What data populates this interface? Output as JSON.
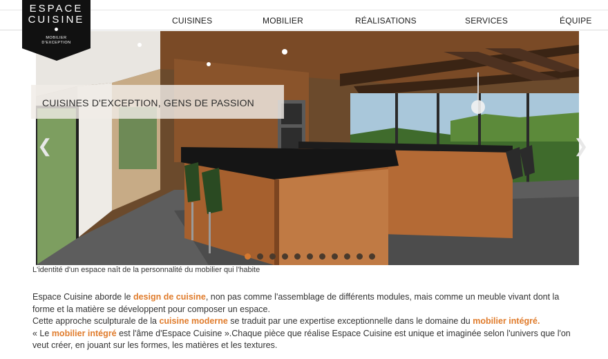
{
  "logo": {
    "line1": "ESPACE",
    "line2": "CUISINE",
    "tagline1": "MOBILIER",
    "tagline2": "D'EXCEPTION"
  },
  "nav": {
    "items": [
      {
        "label": "CUISINES"
      },
      {
        "label": "MOBILIER"
      },
      {
        "label": "RÉALISATIONS"
      },
      {
        "label": "SERVICES"
      },
      {
        "label": "ÉQUIPE"
      }
    ]
  },
  "slider": {
    "caption": "CUISINES D'EXCEPTION, GENS DE PASSION",
    "prev_icon": "chevron-left-icon",
    "next_icon": "chevron-right-icon",
    "slide_count": 11,
    "active_index": 0,
    "dot_active_color": "#d4782f",
    "dot_color": "#4a3a2c"
  },
  "photo_caption": "L'identité d'un espace naît de la personnalité du mobilier qui l'habite",
  "intro": {
    "p1_before": "Espace Cuisine aborde le ",
    "p1_link": "design de cuisine",
    "p1_after": ", non pas comme l'assemblage de différents modules, mais comme un meuble vivant dont la forme et la matière se développent pour composer un espace.",
    "p2_before": "Cette approche sculpturale de la ",
    "p2_link1": "cuisine moderne",
    "p2_middle": " se traduit par une expertise exceptionnelle dans le domaine du ",
    "p2_link2": "mobilier intégré.",
    "p3_before": "« Le ",
    "p3_link": "mobilier intégré",
    "p3_after": " est l'âme d'Espace Cuisine ».Chaque pièce que réalise Espace Cuisine est unique et imaginée selon l'univers que l'on veut créer, en jouant sur les formes, les matières et les textures.",
    "link_color": "#e07c2c"
  }
}
